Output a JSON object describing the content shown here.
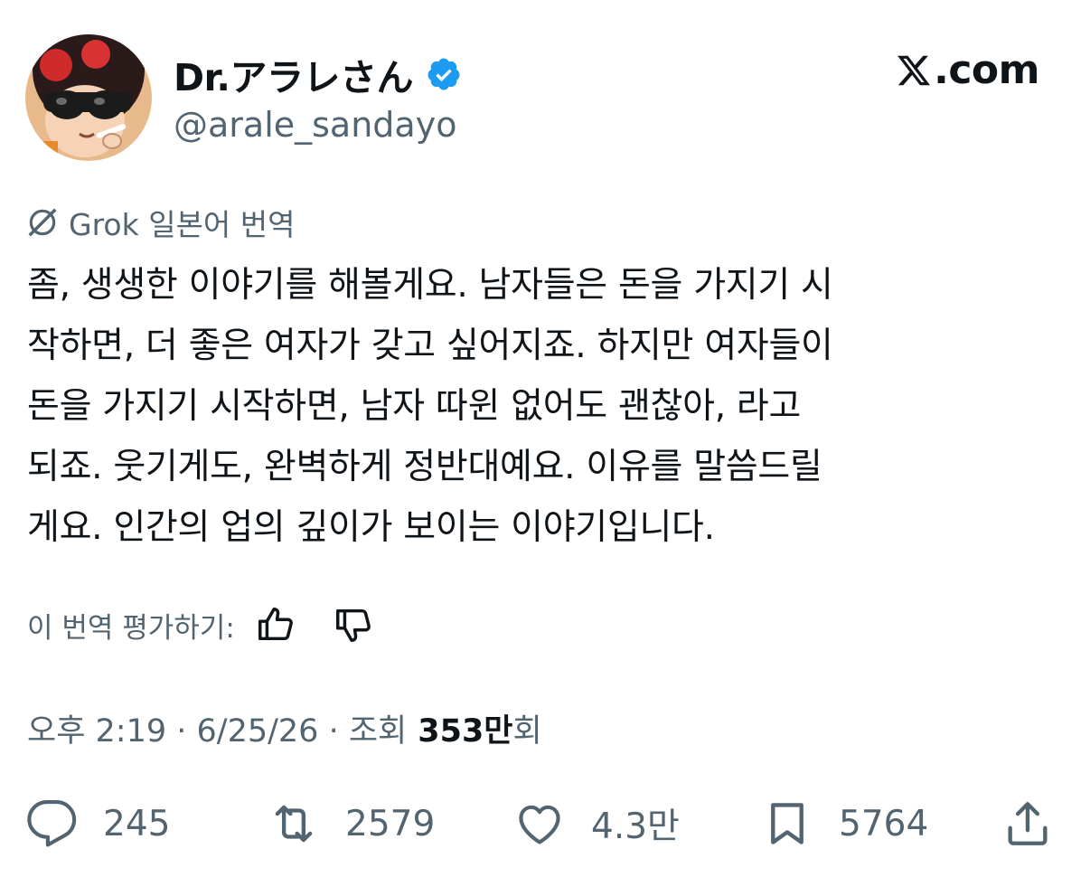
{
  "author": {
    "display_name": "Dr.アラレさん",
    "handle": "@arale_sandayo",
    "verified": true,
    "avatar": "anime-girl-sunglasses-avatar"
  },
  "site_label": ".com",
  "translation": {
    "label": "Grok 일본어 번역",
    "icon": "grok-icon"
  },
  "tweet": {
    "lines": [
      "좀, 생생한 이야기를 해볼게요. 남자들은 돈을 가지기 시",
      "작하면, 더 좋은 여자가 갖고 싶어지죠. 하지만 여자들이",
      "돈을 가지기 시작하면, 남자 따윈 없어도 괜찮아, 라고",
      "되죠. 웃기게도, 완벽하게 정반대예요. 이유를 말씀드릴",
      "게요. 인간의 업의 깊이가 보이는 이야기입니다."
    ]
  },
  "rate": {
    "label": "이 번역 평가하기:"
  },
  "meta": {
    "time": "오후 2:19",
    "date": "6/25/26",
    "views_label": "조회",
    "views_count": "353만",
    "views_suffix": "회"
  },
  "actions": {
    "replies": "245",
    "reposts": "2579",
    "likes": "4.3만",
    "bookmarks": "5764"
  },
  "colors": {
    "text": "#0f1419",
    "secondary": "#536471",
    "verified_blue": "#1d9bf0"
  }
}
